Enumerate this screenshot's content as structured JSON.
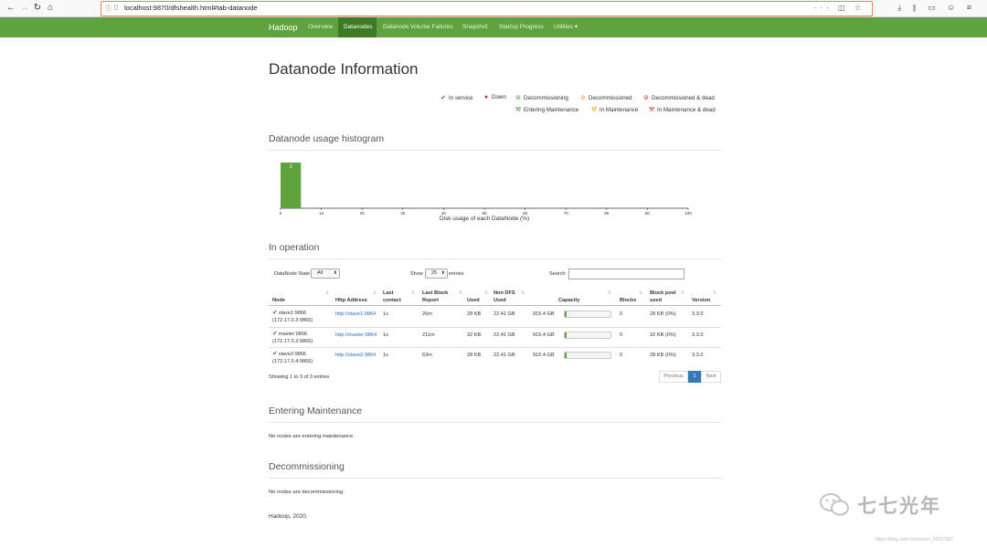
{
  "browser": {
    "url": "localhost:9870/dfshealth.html#tab-datanode"
  },
  "nav": {
    "brand": "Hadoop",
    "items": [
      "Overview",
      "Datanodes",
      "Datanode Volume Failures",
      "Snapshot",
      "Startup Progress",
      "Utilities ▾"
    ]
  },
  "page": {
    "title": "Datanode Information"
  },
  "legend": {
    "in_service": "In service",
    "down": "Down",
    "decommissioning": "Decommissioning",
    "decommissioned": "Decommissioned",
    "decommissioned_dead": "Decommissioned & dead",
    "entering_maintenance": "Entering Maintenance",
    "in_maintenance": "In Maintenance",
    "in_maintenance_dead": "In Maintenance & dead"
  },
  "histogram": {
    "heading": "Datanode usage histogram",
    "xlabel": "Disk usage of each DataNode (%)"
  },
  "chart_data": {
    "type": "bar",
    "bins": [
      [
        0,
        5
      ]
    ],
    "values": [
      3
    ],
    "bar_label": "3",
    "xticks": [
      0,
      10,
      20,
      30,
      40,
      50,
      60,
      70,
      80,
      90,
      100
    ],
    "xlim": [
      0,
      100
    ],
    "xlabel": "Disk usage of each DataNode (%)",
    "color": "#5fa33e"
  },
  "operation": {
    "heading": "In operation",
    "state_label": "DataNode State",
    "state_value": "All",
    "show_label": "Show",
    "show_value": "25",
    "entries_label": "entries",
    "search_label": "Search:",
    "columns": [
      "Node",
      "Http Address",
      "Last contact",
      "Last Block Report",
      "Used",
      "Non DFS Used",
      "Capacity",
      "Blocks",
      "Block pool used",
      "Version"
    ],
    "col_lines": {
      "last_contact": [
        "Last",
        "contact"
      ],
      "last_block_report": [
        "Last Block",
        "Report"
      ],
      "non_dfs": [
        "Non DFS",
        "Used"
      ],
      "block_pool": [
        "Block pool",
        "used"
      ]
    },
    "rows": [
      {
        "node": "slave1:9866",
        "ip": "(172.17.0.3:9866)",
        "http": "http://slave1:9864",
        "contact": "1s",
        "report": "26m",
        "used": "28 KB",
        "nondfs": "22.41 GB",
        "capacity": "915.4 GB",
        "blocks": "0",
        "pool": "28 KB (0%)",
        "version": "3.3.0",
        "usage": 0.03
      },
      {
        "node": "master:9866",
        "ip": "(172.17.0.2:9866)",
        "http": "http://master:9864",
        "contact": "1s",
        "report": "211m",
        "used": "32 KB",
        "nondfs": "22.41 GB",
        "capacity": "915.4 GB",
        "blocks": "0",
        "pool": "32 KB (0%)",
        "version": "3.3.0",
        "usage": 0.03
      },
      {
        "node": "slave2:9866",
        "ip": "(172.17.0.4:9866)",
        "http": "http://slave2:9864",
        "contact": "1s",
        "report": "63m",
        "used": "28 KB",
        "nondfs": "22.41 GB",
        "capacity": "915.4 GB",
        "blocks": "0",
        "pool": "28 KB (0%)",
        "version": "3.3.0",
        "usage": 0.03
      }
    ],
    "info": "Showing 1 to 3 of 3 entries",
    "pager": {
      "previous": "Previous",
      "page": "1",
      "next": "Next"
    }
  },
  "maintenance": {
    "heading": "Entering Maintenance",
    "note": "No nodes are entering maintenance."
  },
  "decommissioning": {
    "heading": "Decommissioning",
    "note": "No nodes are decommissioning."
  },
  "footer": {
    "text": "Hadoop, 2020."
  },
  "watermark": {
    "text": "七七光年",
    "url": "https://blog.csdn.net/weixin_43037587"
  },
  "colors": {
    "navbar": "#5fa33e",
    "nav_active": "#3e7a24",
    "green": "#3c8c2b",
    "red": "#c9302c",
    "orange": "#ec971f",
    "link": "#2a6ebb"
  }
}
